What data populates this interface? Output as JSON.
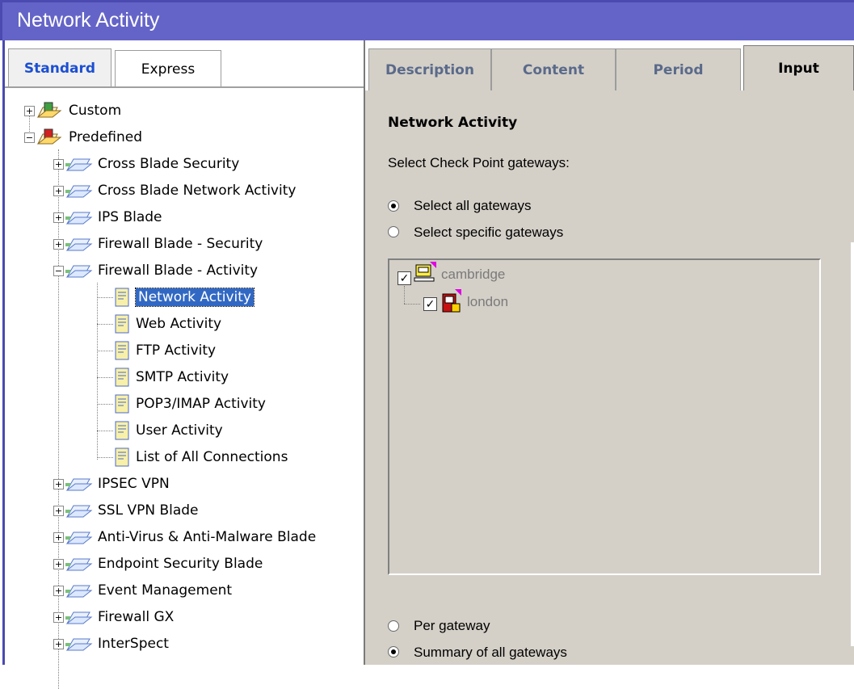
{
  "window": {
    "title": "Network Activity"
  },
  "left_tabs": [
    {
      "label": "Standard",
      "active": true
    },
    {
      "label": "Express",
      "active": false
    }
  ],
  "tree": {
    "custom": "Custom",
    "predefined": "Predefined",
    "categories_before": [
      "Cross Blade Security",
      "Cross Blade Network Activity",
      "IPS Blade",
      "Firewall Blade - Security"
    ],
    "expanded_category": "Firewall Blade - Activity",
    "reports": [
      "Network Activity",
      "Web Activity",
      "FTP Activity",
      "SMTP Activity",
      "POP3/IMAP Activity",
      "User Activity",
      "List of All Connections"
    ],
    "selected_report": "Network Activity",
    "categories_after": [
      "IPSEC VPN",
      "SSL VPN Blade",
      "Anti-Virus & Anti-Malware Blade",
      "Endpoint Security Blade",
      "Event Management",
      "Firewall GX",
      "InterSpect"
    ]
  },
  "right_tabs": [
    {
      "label": "Description",
      "active": false
    },
    {
      "label": "Content",
      "active": false
    },
    {
      "label": "Period",
      "active": false
    },
    {
      "label": "Input",
      "active": true
    }
  ],
  "input_panel": {
    "section_title": "Network Activity",
    "prompt": "Select Check Point gateways:",
    "gateway_options": [
      {
        "label": "Select all gateways",
        "selected": true
      },
      {
        "label": "Select specific gateways",
        "selected": false
      }
    ],
    "gateways": [
      {
        "name": "cambridge",
        "checked": true,
        "icon": "gateway-cluster-icon"
      },
      {
        "name": "london",
        "checked": true,
        "icon": "firewall-gateway-icon"
      }
    ],
    "grouping_options": [
      {
        "label": "Per gateway",
        "selected": false
      },
      {
        "label": "Summary of all gateways",
        "selected": true
      }
    ]
  },
  "colors": {
    "titlebar": "#6464c8",
    "panel_bg": "#d4d0c8",
    "selection": "#3168c4",
    "active_tab_text": "#1c4fd2"
  }
}
